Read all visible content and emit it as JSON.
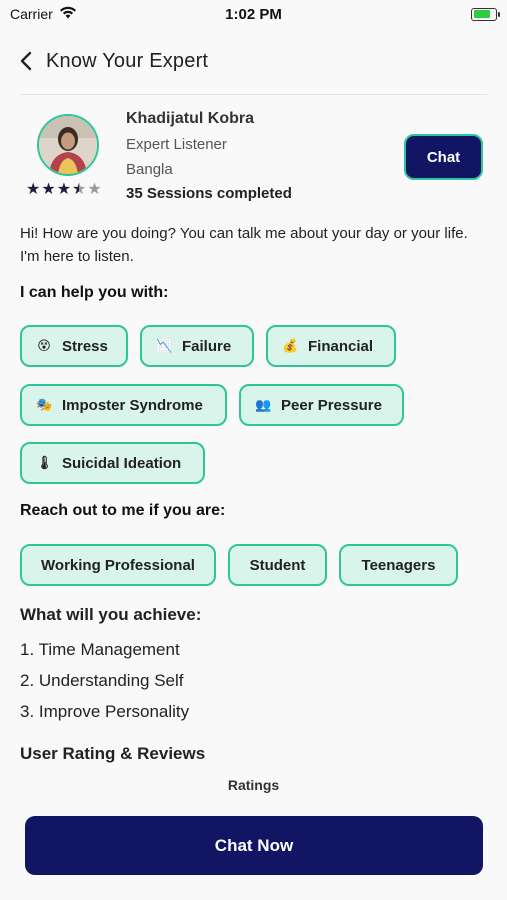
{
  "status": {
    "carrier": "Carrier",
    "time": "1:02 PM"
  },
  "nav": {
    "title": "Know Your Expert",
    "back_icon": "chevron-left-icon"
  },
  "profile": {
    "name": "Khadijatul Kobra",
    "role": "Expert Listener",
    "language": "Bangla",
    "sessions": "35 Sessions completed",
    "rating": 3.5,
    "rating_max": 5,
    "chat_label": "Chat"
  },
  "bio": "Hi! How are you doing?  You can talk me about your day or your life. I'm here to listen.",
  "help": {
    "title": "I can help you with:",
    "items": [
      {
        "label": "Stress",
        "icon": "😵"
      },
      {
        "label": "Failure",
        "icon": "📉"
      },
      {
        "label": "Financial",
        "icon": "💰"
      },
      {
        "label": "Imposter Syndrome",
        "icon": "🎭"
      },
      {
        "label": "Peer Pressure",
        "icon": "👥"
      },
      {
        "label": "Suicidal Ideation",
        "icon": "🌡"
      }
    ]
  },
  "reach": {
    "title": "Reach out to me if you are:",
    "items": [
      "Working Professional",
      "Student",
      "Teenagers"
    ]
  },
  "achieve": {
    "title": "What will you achieve:",
    "items": [
      "1. Time Management",
      "2. Understanding Self",
      "3. Improve Personality"
    ]
  },
  "reviews": {
    "title": "User Rating & Reviews",
    "ratings_label": "Ratings"
  },
  "cta": {
    "label": "Chat Now"
  },
  "colors": {
    "accent": "#2cc69a",
    "primary": "#121464",
    "chip_bg": "#d9f4ea"
  }
}
